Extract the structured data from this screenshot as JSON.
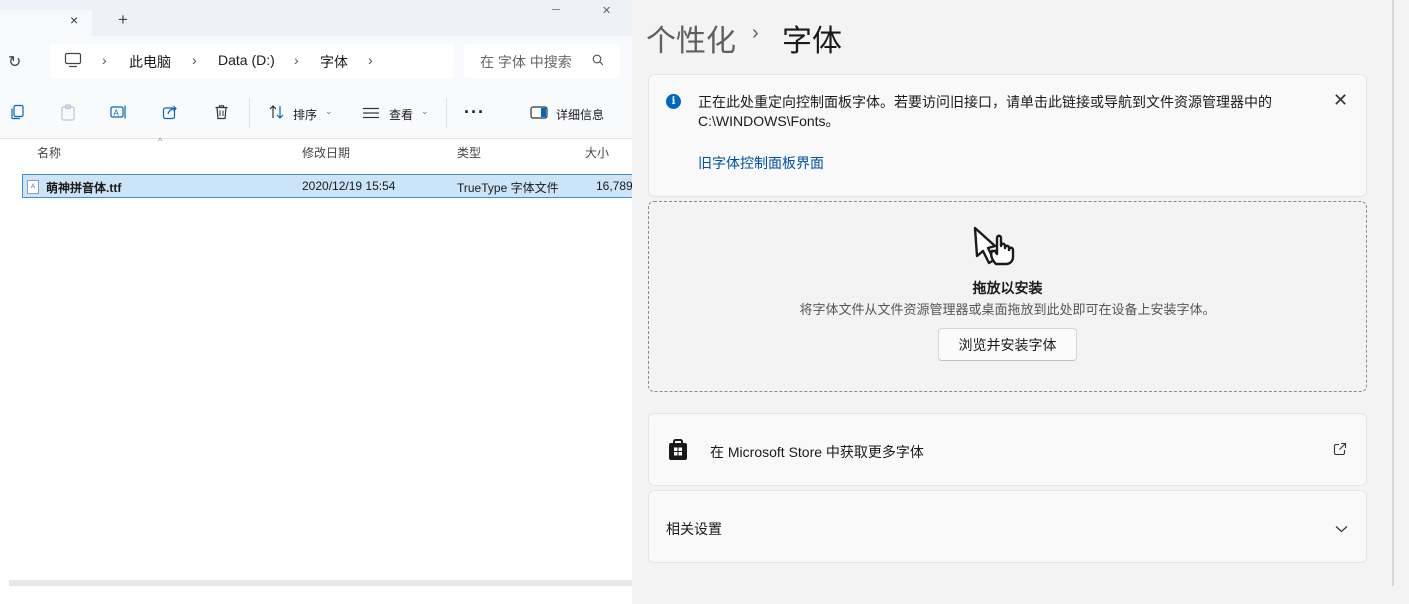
{
  "explorer": {
    "tab_close": "×",
    "new_tab": "+",
    "window_controls": [
      "─",
      "✕"
    ],
    "address": {
      "crumbs": [
        "此电脑",
        "Data (D:)",
        "字体"
      ],
      "separator": "›"
    },
    "search": {
      "placeholder": "在 字体 中搜索"
    },
    "toolbar": {
      "sort_label": "排序",
      "view_label": "查看",
      "more_label": "···",
      "details_label": "详细信息"
    },
    "columns": {
      "name": "名称",
      "modified": "修改日期",
      "type": "类型",
      "size": "大小"
    },
    "files": [
      {
        "name": "萌神拼音体.ttf",
        "modified": "2020/12/19 15:54",
        "type": "TrueType 字体文件",
        "size": "16,789"
      }
    ]
  },
  "settings": {
    "breadcrumb_parent": "个性化",
    "breadcrumb_separator": "›",
    "page_title": "字体",
    "info_icon": "i",
    "info_text": "正在此处重定向控制面板字体。若要访问旧接口，请单击此链接或导航到文件资源管理器中的 C:\\WINDOWS\\Fonts。",
    "info_link": "旧字体控制面板界面",
    "info_close": "✕",
    "drop_title": "拖放以安装",
    "drop_subtitle": "将字体文件从文件资源管理器或桌面拖放到此处即可在设备上安装字体。",
    "browse_button": "浏览并安装字体",
    "store_label": "在 Microsoft Store 中获取更多字体",
    "related_label": "相关设置"
  },
  "colors": {
    "accent": "#0067c0",
    "selection": "#cce4f7",
    "selection_border": "#3b8fd6",
    "link": "#0050a8"
  }
}
